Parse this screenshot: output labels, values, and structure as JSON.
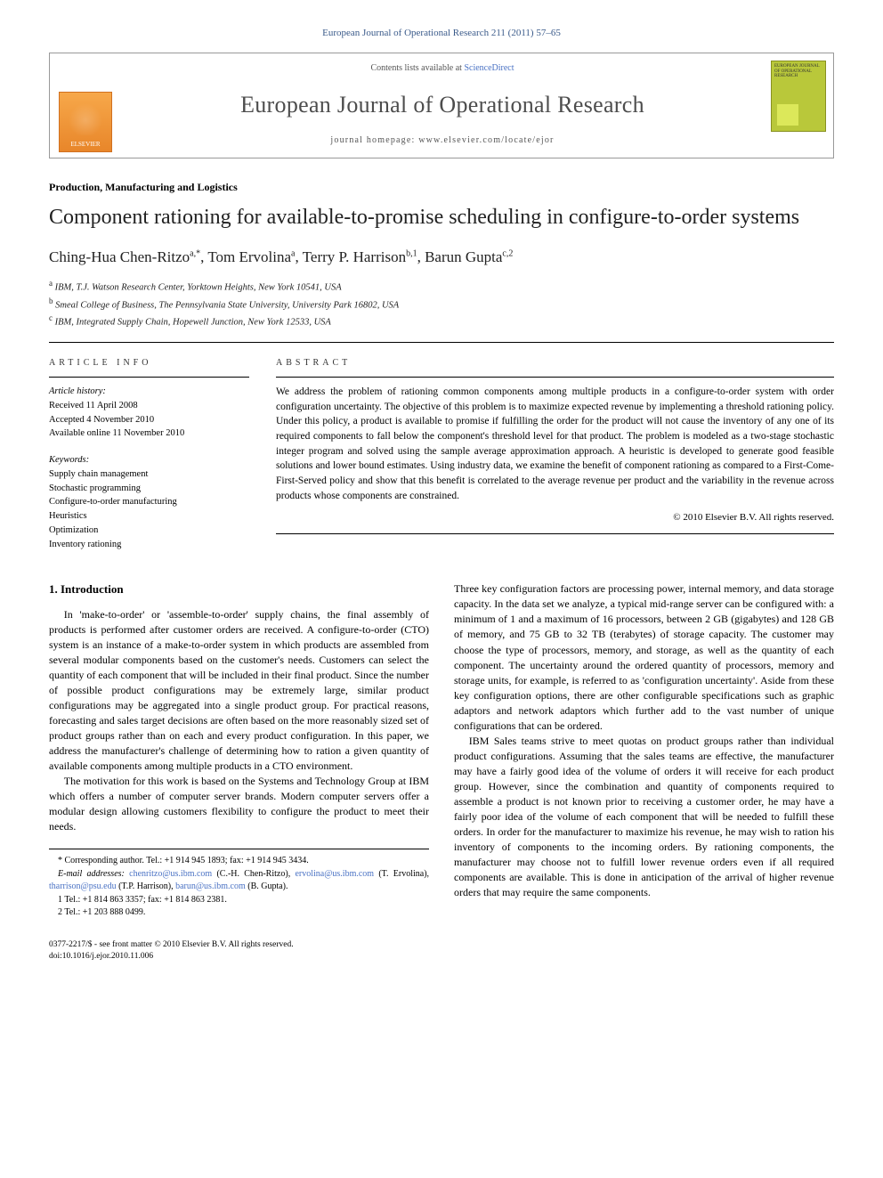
{
  "journal_ref": "European Journal of Operational Research 211 (2011) 57–65",
  "header": {
    "contents_prefix": "Contents lists available at ",
    "contents_link": "ScienceDirect",
    "journal_title": "European Journal of Operational Research",
    "homepage_prefix": "journal homepage: ",
    "homepage_url": "www.elsevier.com/locate/ejor",
    "publisher_logo_label": "ELSEVIER",
    "cover_text": "EUROPEAN JOURNAL OF OPERATIONAL RESEARCH"
  },
  "section_label": "Production, Manufacturing and Logistics",
  "title": "Component rationing for available-to-promise scheduling in configure-to-order systems",
  "authors_line": "Ching-Hua Chen-Ritzo a,*, Tom Ervolina a, Terry P. Harrison b,1, Barun Gupta c,2",
  "authors": [
    {
      "name": "Ching-Hua Chen-Ritzo",
      "sup": "a,*"
    },
    {
      "name": "Tom Ervolina",
      "sup": "a"
    },
    {
      "name": "Terry P. Harrison",
      "sup": "b,1"
    },
    {
      "name": "Barun Gupta",
      "sup": "c,2"
    }
  ],
  "affiliations": [
    {
      "sup": "a",
      "text": "IBM, T.J. Watson Research Center, Yorktown Heights, New York 10541, USA"
    },
    {
      "sup": "b",
      "text": "Smeal College of Business, The Pennsylvania State University, University Park 16802, USA"
    },
    {
      "sup": "c",
      "text": "IBM, Integrated Supply Chain, Hopewell Junction, New York 12533, USA"
    }
  ],
  "article_info": {
    "head": "ARTICLE INFO",
    "history_head": "Article history:",
    "history": [
      "Received 11 April 2008",
      "Accepted 4 November 2010",
      "Available online 11 November 2010"
    ],
    "keywords_head": "Keywords:",
    "keywords": [
      "Supply chain management",
      "Stochastic programming",
      "Configure-to-order manufacturing",
      "Heuristics",
      "Optimization",
      "Inventory rationing"
    ]
  },
  "abstract": {
    "head": "ABSTRACT",
    "text": "We address the problem of rationing common components among multiple products in a configure-to-order system with order configuration uncertainty. The objective of this problem is to maximize expected revenue by implementing a threshold rationing policy. Under this policy, a product is available to promise if fulfilling the order for the product will not cause the inventory of any one of its required components to fall below the component's threshold level for that product. The problem is modeled as a two-stage stochastic integer program and solved using the sample average approximation approach. A heuristic is developed to generate good feasible solutions and lower bound estimates. Using industry data, we examine the benefit of component rationing as compared to a First-Come-First-Served policy and show that this benefit is correlated to the average revenue per product and the variability in the revenue across products whose components are constrained.",
    "copyright": "© 2010 Elsevier B.V. All rights reserved."
  },
  "body": {
    "h_intro": "1. Introduction",
    "p1": "In 'make-to-order' or 'assemble-to-order' supply chains, the final assembly of products is performed after customer orders are received. A configure-to-order (CTO) system is an instance of a make-to-order system in which products are assembled from several modular components based on the customer's needs. Customers can select the quantity of each component that will be included in their final product. Since the number of possible product configurations may be extremely large, similar product configurations may be aggregated into a single product group. For practical reasons, forecasting and sales target decisions are often based on the more reasonably sized set of product groups rather than on each and every product configuration. In this paper, we address the manufacturer's challenge of determining how to ration a given quantity of available components among multiple products in a CTO environment.",
    "p2": "The motivation for this work is based on the Systems and Technology Group at IBM which offers a number of computer server brands. Modern computer servers offer a modular design allowing customers flexibility to configure the product to meet their needs.",
    "p3": "Three key configuration factors are processing power, internal memory, and data storage capacity. In the data set we analyze, a typical mid-range server can be configured with: a minimum of 1 and a maximum of 16 processors, between 2 GB (gigabytes) and 128 GB of memory, and 75 GB to 32 TB (terabytes) of storage capacity. The customer may choose the type of processors, memory, and storage, as well as the quantity of each component. The uncertainty around the ordered quantity of processors, memory and storage units, for example, is referred to as 'configuration uncertainty'. Aside from these key configuration options, there are other configurable specifications such as graphic adaptors and network adaptors which further add to the vast number of unique configurations that can be ordered.",
    "p4": "IBM Sales teams strive to meet quotas on product groups rather than individual product configurations. Assuming that the sales teams are effective, the manufacturer may have a fairly good idea of the volume of orders it will receive for each product group. However, since the combination and quantity of components required to assemble a product is not known prior to receiving a customer order, he may have a fairly poor idea of the volume of each component that will be needed to fulfill these orders. In order for the manufacturer to maximize his revenue, he may wish to ration his inventory of components to the incoming orders. By rationing components, the manufacturer may choose not to fulfill lower revenue orders even if all required components are available. This is done in anticipation of the arrival of higher revenue orders that may require the same components."
  },
  "footnotes": {
    "corr": "* Corresponding author. Tel.: +1 914 945 1893; fax: +1 914 945 3434.",
    "email_label": "E-mail addresses:",
    "emails": [
      {
        "addr": "chenritzo@us.ibm.com",
        "who": "(C.-H. Chen-Ritzo)"
      },
      {
        "addr": "ervolina@us.ibm.com",
        "who": "(T. Ervolina)"
      },
      {
        "addr": "tharrison@psu.edu",
        "who": "(T.P. Harrison)"
      },
      {
        "addr": "barun@us.ibm.com",
        "who": "(B. Gupta)"
      }
    ],
    "fn1": "1 Tel.: +1 814 863 3357; fax: +1 814 863 2381.",
    "fn2": "2 Tel.: +1 203 888 0499."
  },
  "footer": {
    "line1": "0377-2217/$ - see front matter © 2010 Elsevier B.V. All rights reserved.",
    "line2": "doi:10.1016/j.ejor.2010.11.006"
  }
}
